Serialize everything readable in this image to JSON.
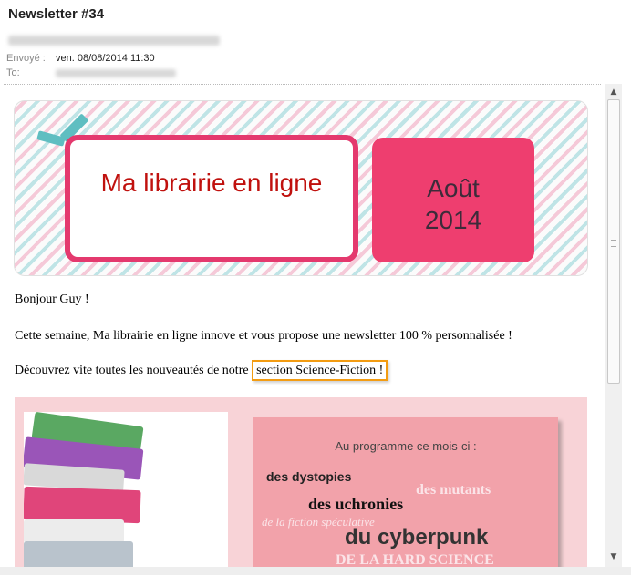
{
  "email": {
    "subject": "Newsletter #34",
    "sent_label": "Envoyé :",
    "sent_value": "ven. 08/08/2014 11:30",
    "to_label": "To:"
  },
  "banner": {
    "title": "Ma librairie en ligne",
    "date_line1": "Août",
    "date_line2": "2014"
  },
  "body": {
    "greeting": "Bonjour Guy !",
    "intro": "Cette semaine, Ma librairie en ligne innove et vous propose une newsletter 100 % personnalisée !",
    "discover_prefix": "Découvrez vite toutes les nouveautés de notre ",
    "discover_link": "section Science-Fiction !"
  },
  "program": {
    "intro": "Au programme ce mois-ci :",
    "words": [
      "des dystopies",
      "des mutants",
      "des uchronies",
      "de la fiction spéculative",
      "du cyberpunk",
      "DE LA HARD SCIENCE"
    ]
  },
  "colors": {
    "accent_pink": "#ee3e6f",
    "title_red": "#c0110e",
    "highlight_orange": "#f39c12",
    "panel_pink": "#f8d3d7"
  }
}
